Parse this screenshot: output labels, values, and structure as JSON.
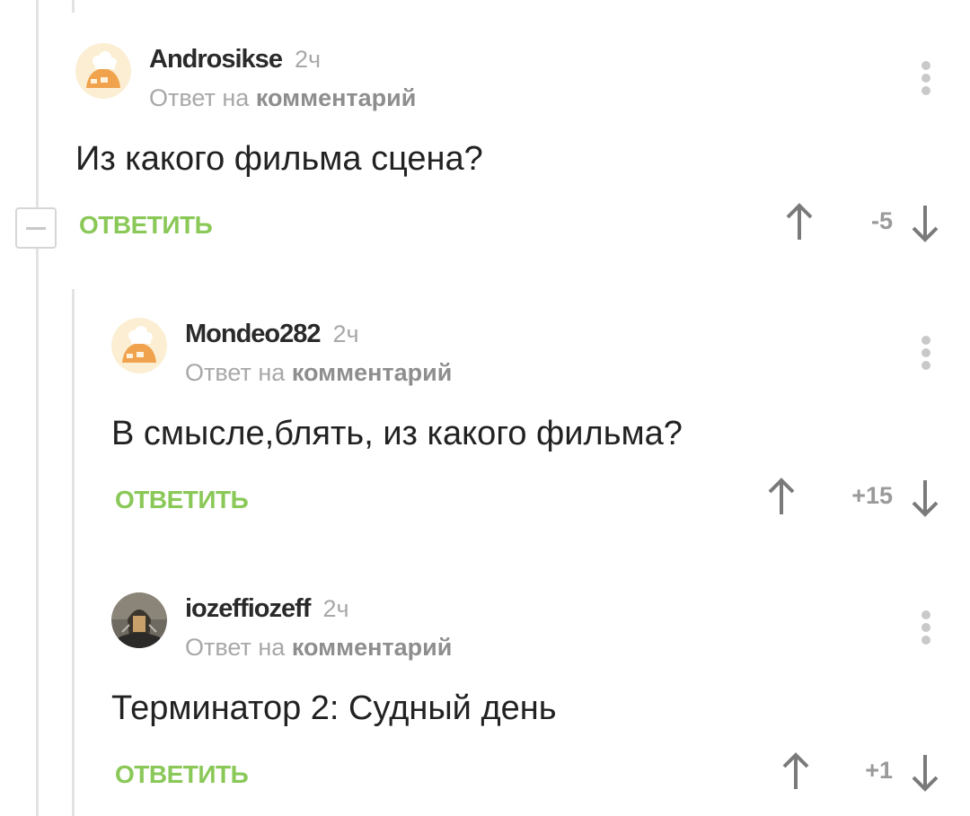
{
  "comments": [
    {
      "author": "Androsikse",
      "time": "2ч",
      "reply_prefix": "Ответ на",
      "reply_target": "комментарий",
      "text": "Из какого фильма сцена?",
      "reply_label": "ОТВЕТИТЬ",
      "score": "-5"
    },
    {
      "author": "Mondeo282",
      "time": "2ч",
      "reply_prefix": "Ответ на",
      "reply_target": "комментарий",
      "text": "В смысле,блять, из какого фильма?",
      "reply_label": "ОТВЕТИТЬ",
      "score": "+15"
    },
    {
      "author": "iozeffiozeff",
      "time": "2ч",
      "reply_prefix": "Ответ на",
      "reply_target": "комментарий",
      "text": "Терминатор 2: Судный день",
      "reply_label": "ОТВЕТИТЬ",
      "score": "+1"
    }
  ],
  "colors": {
    "accent_green": "#8ac858",
    "muted_gray": "#a8a8a8"
  }
}
